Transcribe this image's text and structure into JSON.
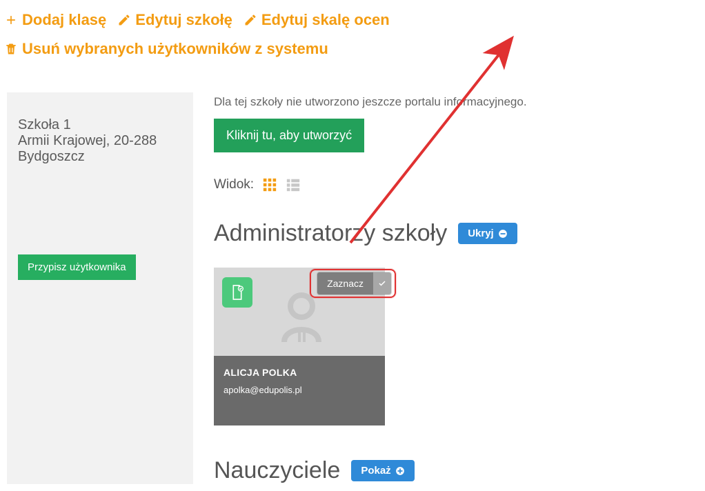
{
  "toolbar": {
    "add_class": "Dodaj klasę",
    "edit_school": "Edytuj szkołę",
    "edit_gradescale": "Edytuj skalę ocen",
    "delete_users": "Usuń wybranych użytkowników z systemu"
  },
  "sidebar": {
    "school_name": "Szkoła 1",
    "street": "Armii Krajowej, 20-288",
    "city": "Bydgoszcz",
    "assign_label": "Przypisz użytkownika"
  },
  "portal": {
    "info_text": "Dla tej szkoły nie utworzono jeszcze portalu informacyjnego.",
    "create_label": "Kliknij tu, aby utworzyć"
  },
  "view": {
    "label": "Widok:"
  },
  "sections": {
    "admins_title": "Administratorzy szkoły",
    "hide_label": "Ukryj",
    "teachers_title": "Nauczyciele",
    "show_label": "Pokaż"
  },
  "user_card": {
    "select_label": "Zaznacz",
    "name": "ALICJA POLKA",
    "email": "apolka@edupolis.pl"
  }
}
